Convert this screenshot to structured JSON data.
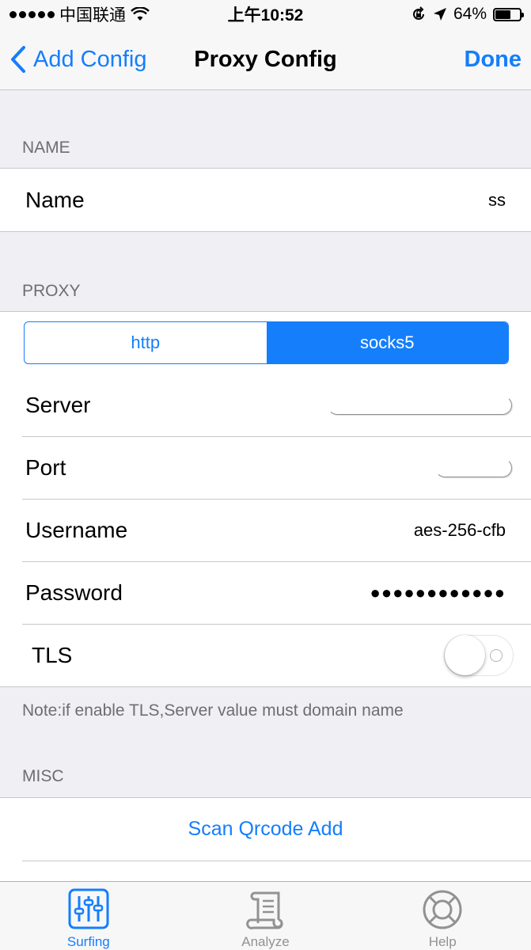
{
  "status_bar": {
    "carrier": "中国联通",
    "time": "上午10:52",
    "battery": "64%",
    "battery_level": 0.64
  },
  "nav": {
    "back_label": "Add Config",
    "title": "Proxy Config",
    "done_label": "Done"
  },
  "sections": {
    "name_header": "NAME",
    "proxy_header": "PROXY",
    "misc_header": "MISC"
  },
  "name_row": {
    "label": "Name",
    "value": "ss"
  },
  "proxy": {
    "segments": [
      "http",
      "socks5"
    ],
    "selected": "socks5",
    "server_label": "Server",
    "port_label": "Port",
    "username_label": "Username",
    "username_value": "aes-256-cfb",
    "password_label": "Password",
    "password_value": "●●●●●●●●●●●●",
    "tls_label": "TLS",
    "tls_enabled": false
  },
  "note": "Note:if enable TLS,Server value must domain name",
  "misc": {
    "scan_label": "Scan Qrcode Add"
  },
  "tabs": [
    {
      "label": "Surfing",
      "icon": "sliders-icon",
      "active": true
    },
    {
      "label": "Analyze",
      "icon": "scroll-icon",
      "active": false
    },
    {
      "label": "Help",
      "icon": "lifebuoy-icon",
      "active": false
    }
  ],
  "colors": {
    "accent": "#157efb",
    "background": "#efeff4",
    "inactive": "#929292"
  }
}
